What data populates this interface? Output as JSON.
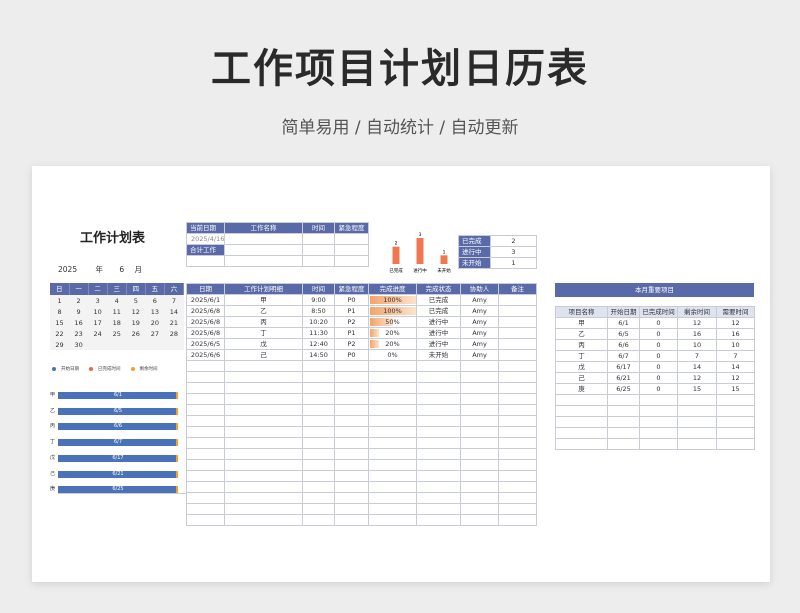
{
  "header": {
    "title": "工作项目计划日历表",
    "subtitle": "简单易用  /  自动统计  /  自动更新"
  },
  "sheet": {
    "title": "工作计划表",
    "calendar": {
      "year": "2025",
      "year_unit": "年",
      "month": "6",
      "month_unit": "月",
      "weekdays": [
        "日",
        "一",
        "二",
        "三",
        "四",
        "五",
        "六"
      ],
      "weeks": [
        [
          "1",
          "2",
          "3",
          "4",
          "5",
          "6",
          "7"
        ],
        [
          "8",
          "9",
          "10",
          "11",
          "12",
          "13",
          "14"
        ],
        [
          "15",
          "16",
          "17",
          "18",
          "19",
          "20",
          "21"
        ],
        [
          "22",
          "23",
          "24",
          "25",
          "26",
          "27",
          "28"
        ],
        [
          "29",
          "30",
          "",
          "",
          "",
          "",
          ""
        ]
      ]
    },
    "gantt": {
      "legend": [
        "开始日期",
        "已完成时间",
        "剩余时间"
      ],
      "legend_colors": [
        "#4a72b8",
        "#e26b4a",
        "#f0a030"
      ],
      "rows": [
        {
          "name": "甲",
          "date": "6/1"
        },
        {
          "name": "乙",
          "date": "6/5"
        },
        {
          "name": "丙",
          "date": "6/6"
        },
        {
          "name": "丁",
          "date": "6/7"
        },
        {
          "name": "戊",
          "date": "6/17"
        },
        {
          "name": "己",
          "date": "6/21"
        },
        {
          "name": "庚",
          "date": "6/25"
        }
      ]
    },
    "info": {
      "labels": [
        "当前日期",
        "合计工作"
      ],
      "current_date": "2025/4/16",
      "headers": [
        "工作名称",
        "时间",
        "紧急程度"
      ]
    },
    "chart_data": {
      "type": "bar",
      "categories": [
        "已完成",
        "进行中",
        "未开始"
      ],
      "values": [
        2,
        3,
        1
      ],
      "title": "",
      "xlabel": "",
      "ylabel": "",
      "ylim": [
        0,
        3
      ],
      "color": "#f07850"
    },
    "status": {
      "rows": [
        {
          "label": "已完成",
          "value": "2"
        },
        {
          "label": "进行中",
          "value": "3"
        },
        {
          "label": "未开始",
          "value": "1"
        }
      ]
    },
    "tasks": {
      "headers": [
        "日期",
        "工作计划明细",
        "时间",
        "紧急程度",
        "完成进度",
        "完成状态",
        "协助人",
        "备注"
      ],
      "rows": [
        {
          "date": "2025/6/1",
          "detail": "甲",
          "time": "9:00",
          "priority": "P0",
          "progress": "100%",
          "progress_value": 1.0,
          "state": "已完成",
          "helper": "Amy",
          "note": ""
        },
        {
          "date": "2025/6/8",
          "detail": "乙",
          "time": "8:50",
          "priority": "P1",
          "progress": "100%",
          "progress_value": 1.0,
          "state": "已完成",
          "helper": "Amy",
          "note": ""
        },
        {
          "date": "2025/6/8",
          "detail": "丙",
          "time": "10:20",
          "priority": "P2",
          "progress": "50%",
          "progress_value": 0.5,
          "state": "进行中",
          "helper": "Amy",
          "note": ""
        },
        {
          "date": "2025/6/8",
          "detail": "丁",
          "time": "11:30",
          "priority": "P1",
          "progress": "20%",
          "progress_value": 0.2,
          "state": "进行中",
          "helper": "Amy",
          "note": ""
        },
        {
          "date": "2025/6/5",
          "detail": "戊",
          "time": "12:40",
          "priority": "P2",
          "progress": "20%",
          "progress_value": 0.2,
          "state": "进行中",
          "helper": "Amy",
          "note": ""
        },
        {
          "date": "2025/6/6",
          "detail": "己",
          "time": "14:50",
          "priority": "P0",
          "progress": "0%",
          "progress_value": 0,
          "state": "未开始",
          "helper": "Amy",
          "note": ""
        }
      ]
    },
    "projects": {
      "title": "本月重要项目",
      "headers": [
        "项目名称",
        "开始日期",
        "已完成时间",
        "剩余时间",
        "需要时间"
      ],
      "rows": [
        {
          "name": "甲",
          "start": "6/1",
          "done": "0",
          "remain": "12",
          "need": "12"
        },
        {
          "name": "乙",
          "start": "6/5",
          "done": "0",
          "remain": "16",
          "need": "16"
        },
        {
          "name": "丙",
          "start": "6/6",
          "done": "0",
          "remain": "10",
          "need": "10"
        },
        {
          "name": "丁",
          "start": "6/7",
          "done": "0",
          "remain": "7",
          "need": "7"
        },
        {
          "name": "戊",
          "start": "6/17",
          "done": "0",
          "remain": "14",
          "need": "14"
        },
        {
          "name": "己",
          "start": "6/21",
          "done": "0",
          "remain": "12",
          "need": "12"
        },
        {
          "name": "庚",
          "start": "6/25",
          "done": "0",
          "remain": "15",
          "need": "15"
        }
      ]
    }
  }
}
